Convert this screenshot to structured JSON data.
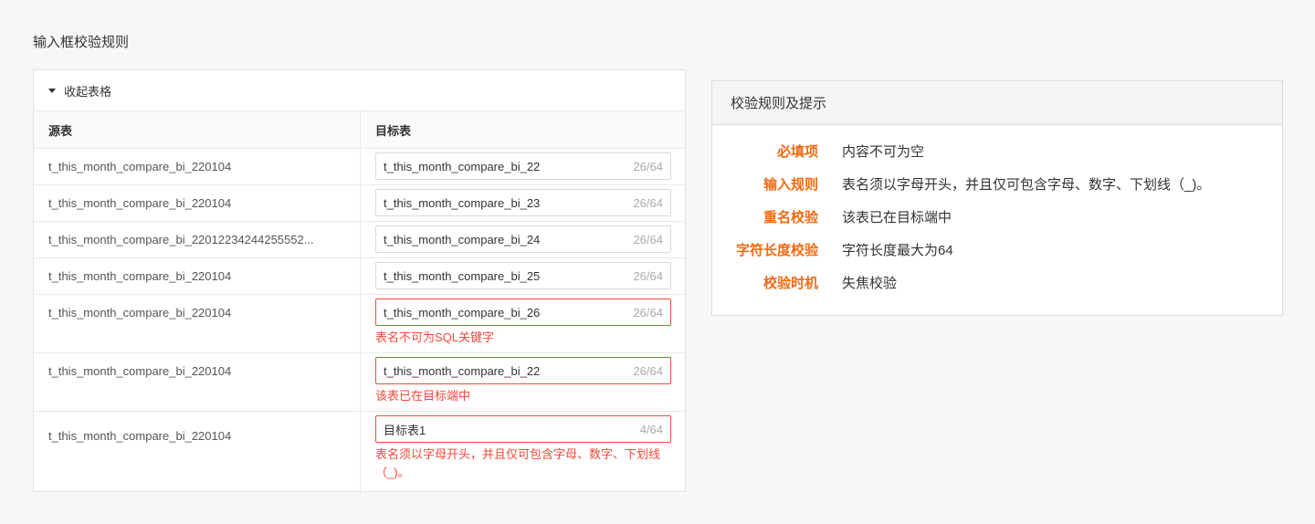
{
  "page_title": "输入框校验规则",
  "table": {
    "collapse_label": "收起表格",
    "headers": {
      "source": "源表",
      "target": "目标表"
    },
    "rows": [
      {
        "source": "t_this_month_compare_bi_220104",
        "target": "t_this_month_compare_bi_22",
        "counter": "26/64",
        "error": ""
      },
      {
        "source": "t_this_month_compare_bi_220104",
        "target": "t_this_month_compare_bi_23",
        "counter": "26/64",
        "error": ""
      },
      {
        "source": "t_this_month_compare_bi_22012234244255552...",
        "target": "t_this_month_compare_bi_24",
        "counter": "26/64",
        "error": ""
      },
      {
        "source": "t_this_month_compare_bi_220104",
        "target": "t_this_month_compare_bi_25",
        "counter": "26/64",
        "error": ""
      },
      {
        "source": "t_this_month_compare_bi_220104",
        "target": "t_this_month_compare_bi_26",
        "counter": "26/64",
        "error": "表名不可为SQL关键字"
      },
      {
        "source": "t_this_month_compare_bi_220104",
        "target": "t_this_month_compare_bi_22",
        "counter": "26/64",
        "error": "该表已在目标端中"
      },
      {
        "source": "t_this_month_compare_bi_220104",
        "target": "目标表1",
        "counter": "4/64",
        "error": "表名须以字母开头，并且仅可包含字母、数字、下划线（_)。"
      }
    ]
  },
  "rules": {
    "title": "校验规则及提示",
    "items": [
      {
        "key": "必填项",
        "value": "内容不可为空"
      },
      {
        "key": "输入规则",
        "value": "表名须以字母开头，并且仅可包含字母、数字、下划线（_)。"
      },
      {
        "key": "重名校验",
        "value": "该表已在目标端中"
      },
      {
        "key": "字符长度校验",
        "value": "字符长度最大为64"
      },
      {
        "key": "校验时机",
        "value": "失焦校验"
      }
    ]
  },
  "colors": {
    "error": "#f5483b",
    "rule_key": "#f06a12"
  }
}
